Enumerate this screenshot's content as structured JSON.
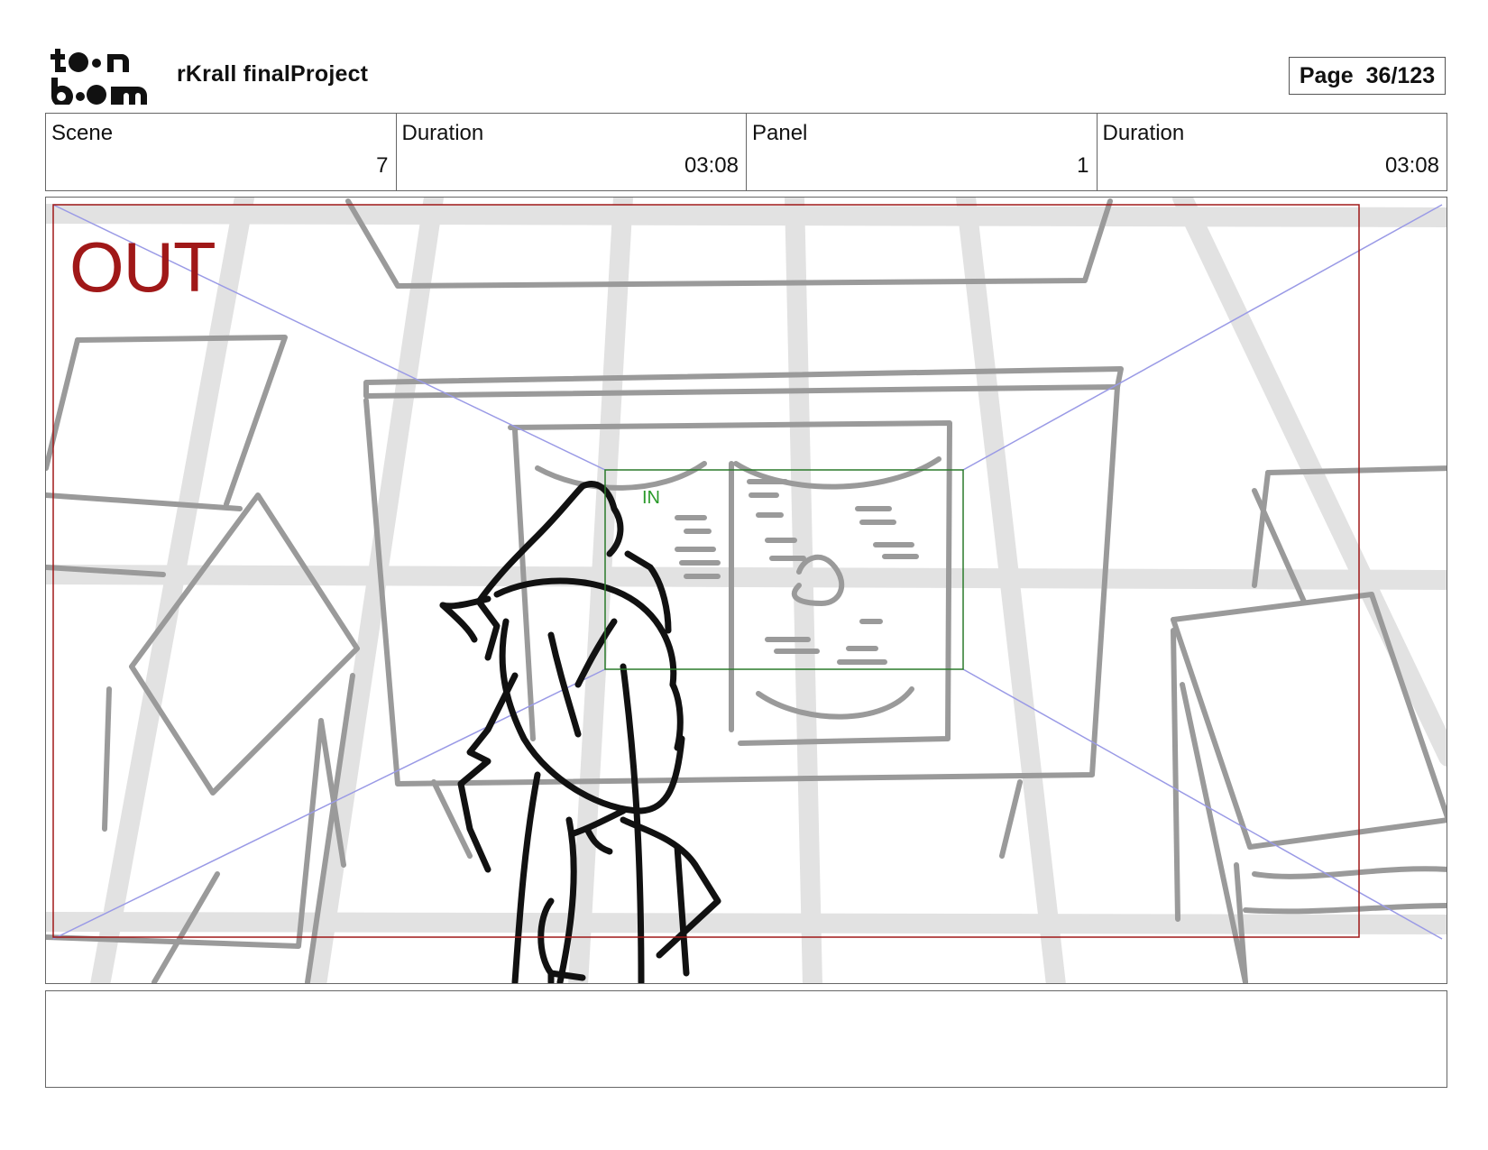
{
  "header": {
    "logo_text": "toon boom",
    "project_title": "rKrall finalProject",
    "page_label": "Page",
    "page_number": "36/123"
  },
  "info": {
    "scene_label": "Scene",
    "scene_value": "7",
    "scene_duration_label": "Duration",
    "scene_duration_value": "03:08",
    "panel_label": "Panel",
    "panel_value": "1",
    "panel_duration_label": "Duration",
    "panel_duration_value": "03:08"
  },
  "panel": {
    "out_label": "OUT",
    "in_label": "IN",
    "out_color": "#a01818",
    "in_color": "#2a7a2a",
    "guide_color": "#8888dd",
    "sketch_gray": "#9a9a9a",
    "character_ink": "#111111"
  },
  "notes": {
    "text": ""
  }
}
